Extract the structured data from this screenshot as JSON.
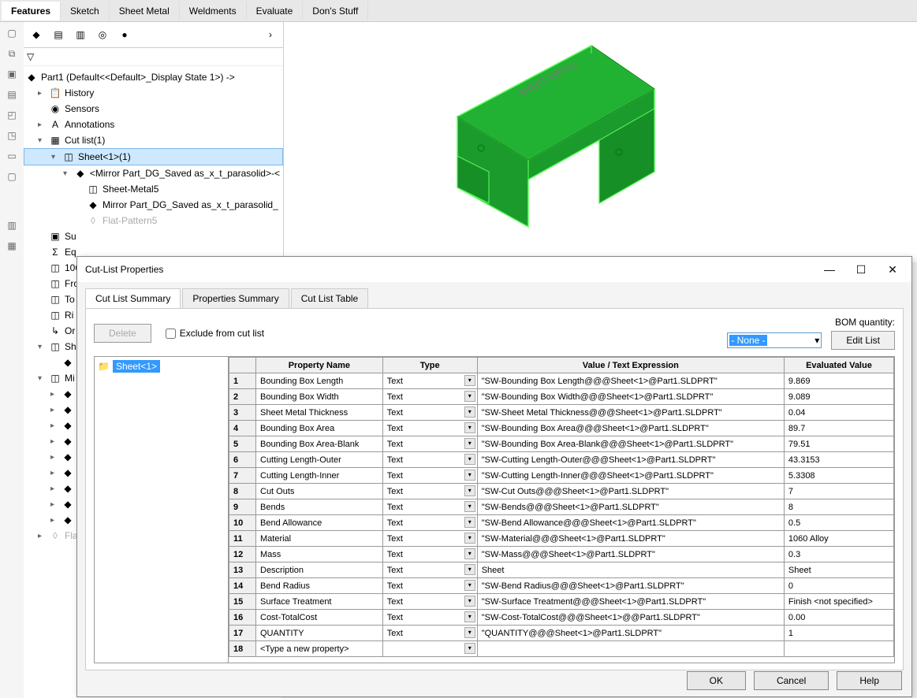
{
  "tabs": {
    "features": "Features",
    "sketch": "Sketch",
    "sheet_metal": "Sheet Metal",
    "weldments": "Weldments",
    "evaluate": "Evaluate",
    "dons": "Don's Stuff"
  },
  "tree": {
    "root": "Part1  (Default<<Default>_Display State 1>)  ->",
    "history": "History",
    "sensors": "Sensors",
    "annotations": "Annotations",
    "cutlist": "Cut list(1)",
    "sheet1": "Sheet<1>(1)",
    "mirror1": "<Mirror Part_DG_Saved as_x_t_parasolid>-<",
    "sheetmetal5": "Sheet-Metal5",
    "mirror_part": "Mirror Part_DG_Saved as_x_t_parasolid_",
    "flatpattern5": "Flat-Pattern5",
    "su": "Su",
    "eq": "Eq",
    "n106": "106",
    "fro": "Fro",
    "top": "To",
    "rig": "Ri",
    "ori": "Or",
    "she": "Sh",
    "mir": "Mi",
    "fla": "Fla"
  },
  "dialog": {
    "title": "Cut-List Properties",
    "tab_summary": "Cut List Summary",
    "tab_props": "Properties Summary",
    "tab_table": "Cut List Table",
    "delete": "Delete",
    "exclude": "Exclude from cut list",
    "bom_label": "BOM quantity:",
    "bom_value": "- None -",
    "edit_list": "Edit List",
    "sidebar_item": "Sheet<1>",
    "col_name": "Property Name",
    "col_type": "Type",
    "col_expr": "Value / Text Expression",
    "col_eval": "Evaluated Value",
    "new_prop": "<Type a new property>",
    "ok": "OK",
    "cancel": "Cancel",
    "help": "Help"
  },
  "props": [
    {
      "n": "1",
      "name": "Bounding Box Length",
      "type": "Text",
      "expr": "\"SW-Bounding Box Length@@@Sheet<1>@Part1.SLDPRT\"",
      "eval": "9.869"
    },
    {
      "n": "2",
      "name": "Bounding Box Width",
      "type": "Text",
      "expr": "\"SW-Bounding Box Width@@@Sheet<1>@Part1.SLDPRT\"",
      "eval": "9.089"
    },
    {
      "n": "3",
      "name": "Sheet Metal Thickness",
      "type": "Text",
      "expr": "\"SW-Sheet Metal Thickness@@@Sheet<1>@Part1.SLDPRT\"",
      "eval": "0.04"
    },
    {
      "n": "4",
      "name": "Bounding Box Area",
      "type": "Text",
      "expr": "\"SW-Bounding Box Area@@@Sheet<1>@Part1.SLDPRT\"",
      "eval": "89.7"
    },
    {
      "n": "5",
      "name": "Bounding Box Area-Blank",
      "type": "Text",
      "expr": "\"SW-Bounding Box Area-Blank@@@Sheet<1>@Part1.SLDPRT\"",
      "eval": "79.51"
    },
    {
      "n": "6",
      "name": "Cutting Length-Outer",
      "type": "Text",
      "expr": "\"SW-Cutting Length-Outer@@@Sheet<1>@Part1.SLDPRT\"",
      "eval": "43.3153"
    },
    {
      "n": "7",
      "name": "Cutting Length-Inner",
      "type": "Text",
      "expr": "\"SW-Cutting Length-Inner@@@Sheet<1>@Part1.SLDPRT\"",
      "eval": "5.3308"
    },
    {
      "n": "8",
      "name": "Cut Outs",
      "type": "Text",
      "expr": "\"SW-Cut Outs@@@Sheet<1>@Part1.SLDPRT\"",
      "eval": "7"
    },
    {
      "n": "9",
      "name": "Bends",
      "type": "Text",
      "expr": "\"SW-Bends@@@Sheet<1>@Part1.SLDPRT\"",
      "eval": "8"
    },
    {
      "n": "10",
      "name": "Bend Allowance",
      "type": "Text",
      "expr": "\"SW-Bend Allowance@@@Sheet<1>@Part1.SLDPRT\"",
      "eval": "0.5"
    },
    {
      "n": "11",
      "name": "Material",
      "type": "Text",
      "expr": "\"SW-Material@@@Sheet<1>@Part1.SLDPRT\"",
      "eval": "1060 Alloy"
    },
    {
      "n": "12",
      "name": "Mass",
      "type": "Text",
      "expr": "\"SW-Mass@@@Sheet<1>@Part1.SLDPRT\"",
      "eval": "0.3"
    },
    {
      "n": "13",
      "name": "Description",
      "type": "Text",
      "expr": "Sheet",
      "eval": "Sheet"
    },
    {
      "n": "14",
      "name": "Bend Radius",
      "type": "Text",
      "expr": "\"SW-Bend Radius@@@Sheet<1>@Part1.SLDPRT\"",
      "eval": "0"
    },
    {
      "n": "15",
      "name": "Surface Treatment",
      "type": "Text",
      "expr": "\"SW-Surface Treatment@@@Sheet<1>@Part1.SLDPRT\"",
      "eval": "Finish <not specified>"
    },
    {
      "n": "16",
      "name": "Cost-TotalCost",
      "type": "Text",
      "expr": "\"SW-Cost-TotalCost@@@Sheet<1>@@Part1.SLDPRT\"",
      "eval": "0.00"
    },
    {
      "n": "17",
      "name": "QUANTITY",
      "type": "Text",
      "expr": "\"QUANTITY@@@Sheet<1>@Part1.SLDPRT\"",
      "eval": "1"
    }
  ]
}
